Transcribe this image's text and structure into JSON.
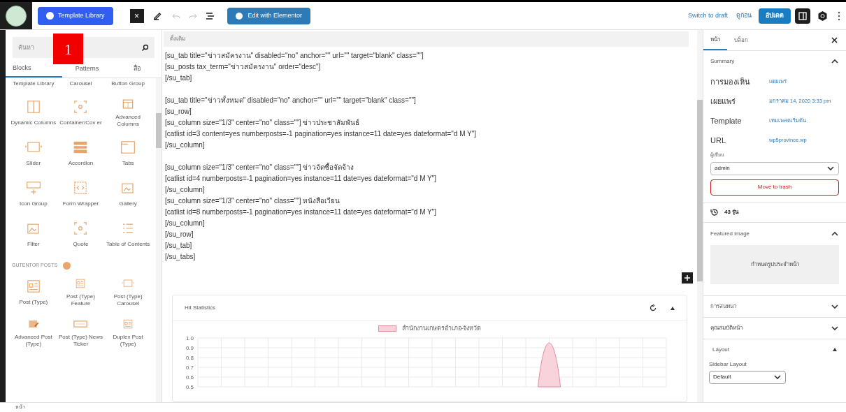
{
  "toolbar": {
    "template_library": "Template Library",
    "close": "×",
    "edit_with_elementor": "Edit with Elementor",
    "undo_disabled": true,
    "redo_disabled": true,
    "switch_to_draft": "Switch to draft",
    "preview": "ดูก่อน",
    "update": "อัปเดต",
    "sidebar_toggle_on": true
  },
  "annotation_marker": "1",
  "inserter": {
    "search": {
      "placeholder": "ค้นหา"
    },
    "tabs": [
      {
        "label": "Blocks",
        "selected": true
      },
      {
        "label": "Patterns",
        "selected": false
      },
      {
        "label": "สื่อ",
        "selected": false
      }
    ],
    "partial_row": [
      "Template Library",
      "Carousel",
      "Button Group"
    ],
    "blocks": [
      {
        "label": "Dynamic Columns",
        "kind": "columns"
      },
      {
        "label": "Container/Cov er",
        "kind": "frame"
      },
      {
        "label": "Advanced Columns",
        "kind": "table"
      },
      {
        "label": "Slider",
        "kind": "slider"
      },
      {
        "label": "Accordion",
        "kind": "stack"
      },
      {
        "label": "Tabs",
        "kind": "tabs"
      },
      {
        "label": "Icon Group",
        "kind": "plus"
      },
      {
        "label": "Form Wrapper",
        "kind": "code"
      },
      {
        "label": "Gallery",
        "kind": "photo"
      },
      {
        "label": "Filter",
        "kind": "photo"
      },
      {
        "label": "Quote",
        "kind": "frame"
      },
      {
        "label": "Table of Contents",
        "kind": "list"
      }
    ],
    "section": "GUTENTOR POSTS",
    "post_blocks": [
      {
        "label": "Post (Type)",
        "kind": "doc"
      },
      {
        "label": "Post (Type) Feature",
        "kind": "doc"
      },
      {
        "label": "Post (Type) Carousel",
        "kind": "slider"
      },
      {
        "label": "Advanced Post (Type)",
        "kind": "edit"
      },
      {
        "label": "Post (Type) News Ticker",
        "kind": "ticker"
      },
      {
        "label": "Duplex Post (Type)",
        "kind": "doc"
      }
    ]
  },
  "editor": {
    "block_label": "ดั้งเดิม",
    "code_groups": [
      [
        "[su_tab title=\"ข่าวสมัครงาน\" disabled=\"no\" anchor=\"\" url=\"\" target=\"blank\" class=\"\"]",
        "[su_posts tax_term=\"ข่าวสมัครงาน\" order=\"desc\"]",
        "[/su_tab]"
      ],
      [
        "[su_tab title=\"ข่าวทั้งหมด\" disabled=\"no\" anchor=\"\" url=\"\" target=\"blank\" class=\"\"]",
        "[su_row]",
        "[su_column size=\"1/3\" center=\"no\" class=\"\"] ข่าวประชาสัมพันธ์",
        "[catlist id=3 content=yes numberposts=-1 pagination=yes instance=11 date=yes dateformat=\"d M Y\"]",
        "[/su_column]"
      ],
      [
        "[su_column size=\"1/3\" center=\"no\" class=\"\"] ข่าวจัดซื้อจัดจ้าง",
        "[catlist id=4 numberposts=-1 pagination=yes instance=11 date=yes dateformat=\"d M Y\"]",
        "[/su_column]",
        "[su_column size=\"1/3\" center=\"no\" class=\"\"] หนังสือเวียน",
        "[catlist id=8 numberposts=-1 pagination=yes instance=11 date=yes dateformat=\"d M Y\"]",
        "[/su_column]",
        "[/su_row]",
        "[/su_tab]",
        "[/su_tabs]"
      ]
    ],
    "stats": {
      "title": "Hit Statistics",
      "legend": "สำนักงานเกษตรอำเภอ-จังหวัด",
      "y_axis_labels": [
        "1.0",
        "0.9",
        "0.8",
        "0.7",
        "0.6",
        "0.5"
      ]
    }
  },
  "settings": {
    "tabs": [
      {
        "label": "หน้า",
        "selected": true
      },
      {
        "label": "บล็อก",
        "selected": false
      }
    ],
    "summary": {
      "title": "Summary",
      "expanded": true,
      "rows": [
        {
          "label": "การมองเห็น",
          "value": "เผยแพร่"
        },
        {
          "label": "เผยแพร่",
          "value": "มกราคม 14, 2020 3:33 pm"
        },
        {
          "label": "Template",
          "value": "เทมเพลตเริ่มต้น"
        },
        {
          "label": "URL",
          "value": "wp5province.wp"
        }
      ],
      "author_label": "ผู้เขียน",
      "author": "admin",
      "trash": "Move to trash"
    },
    "revisions": "43 รุ่น",
    "featured": {
      "title": "Featured image",
      "expanded": true,
      "button": "กำหนดรูปประจำหน้า"
    },
    "panels": [
      {
        "title": "การสนทนา",
        "expanded": false
      },
      {
        "title": "คุณสมบัติหน้า",
        "expanded": false
      }
    ],
    "layout": {
      "title": "Layout",
      "expanded": true,
      "field_label": "Sidebar Layout",
      "value": "Default"
    }
  },
  "breadcrumb": "หน้า"
}
